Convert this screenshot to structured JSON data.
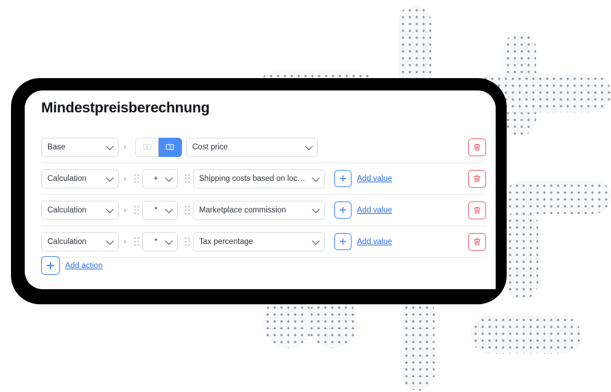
{
  "card": {
    "title": "Mindestpreisberechnung",
    "add_action_label": "Add action",
    "add_action_icon": "plus-icon"
  },
  "icons": {
    "chevron_right": "›",
    "drag_handle": "drag-handle-icon",
    "text_input_mode": "text-input-icon",
    "select_mode": "select-dropdown-icon",
    "delete": "trash-icon",
    "plus": "plus-icon",
    "caret_down": "chevron-down-icon"
  },
  "colors": {
    "accent_blue": "#4b8df8",
    "link_blue": "#2a6fe0",
    "danger_red": "#e8606d",
    "frame_black": "#000000",
    "border_gray": "#d9dde2",
    "divider_gray": "#e9ebee",
    "deco_dot": "#8a9099",
    "deco_fill": "#f7f8f9"
  },
  "rows": [
    {
      "id": "row-base",
      "type": "Base",
      "has_drag_handle": false,
      "has_mode_toggle": true,
      "mode_toggle": {
        "text_mode_active": false,
        "select_mode_active": true
      },
      "operator": null,
      "value": "Cost price",
      "add_value_label": null,
      "delete_label": "Delete"
    },
    {
      "id": "row-calc-1",
      "type": "Calculation",
      "has_drag_handle": true,
      "has_mode_toggle": false,
      "operator": "+",
      "value": "Shipping costs based on location",
      "add_value_label": "Add value",
      "delete_label": "Delete"
    },
    {
      "id": "row-calc-2",
      "type": "Calculation",
      "has_drag_handle": true,
      "has_mode_toggle": false,
      "operator": "*",
      "value": "Marketplace commission",
      "add_value_label": "Add value",
      "delete_label": "Delete"
    },
    {
      "id": "row-calc-3",
      "type": "Calculation",
      "has_drag_handle": true,
      "has_mode_toggle": false,
      "operator": "*",
      "value": "Tax percentage",
      "add_value_label": "Add value",
      "delete_label": "Delete"
    }
  ]
}
